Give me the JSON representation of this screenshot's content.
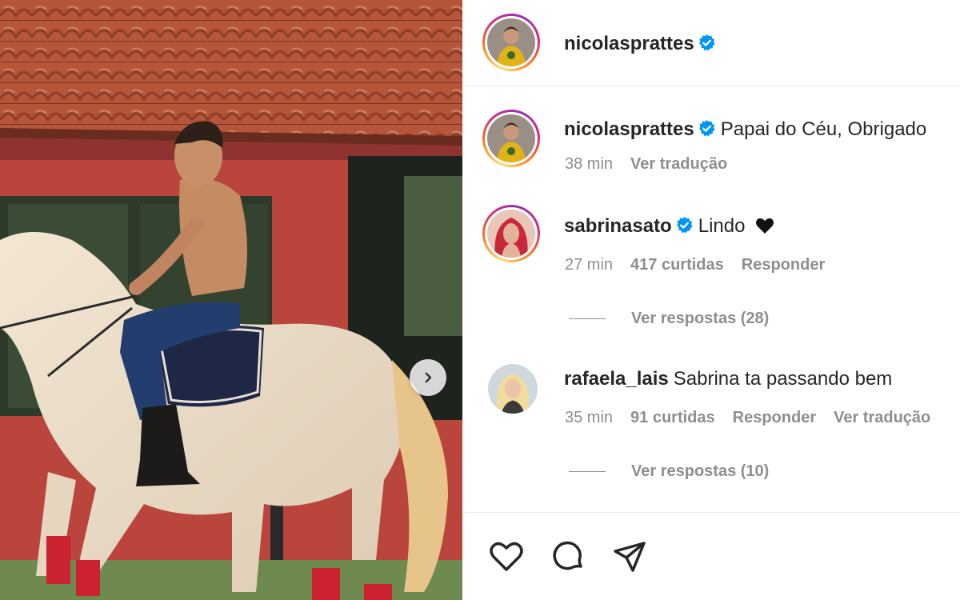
{
  "post": {
    "author": "nicolasprattes",
    "author_verified": true
  },
  "caption": {
    "username": "nicolasprattes",
    "text": "Papai do Céu, Obrigado",
    "time": "38 min",
    "translate": "Ver tradução"
  },
  "comments": [
    {
      "username": "sabrinasato",
      "verified": true,
      "text": "Lindo",
      "emoji": "black-heart",
      "time": "27 min",
      "likes": "417 curtidas",
      "reply": "Responder",
      "view_replies": "Ver respostas (28)"
    },
    {
      "username": "rafaela_lais",
      "verified": false,
      "text": "Sabrina ta passando bem",
      "time": "35 min",
      "likes": "91 curtidas",
      "reply": "Responder",
      "translate": "Ver tradução",
      "view_replies": "Ver respostas (10)"
    }
  ],
  "icons": {
    "like": "heart-icon",
    "comment": "comment-icon",
    "share": "share-icon",
    "next": "chevron-right-icon",
    "verified": "verified-badge-icon"
  },
  "colors": {
    "verified": "#0095f6",
    "text": "#262626",
    "secondary": "#8e8e8e",
    "story_ring": [
      "#feda75",
      "#fa7e1e",
      "#d62976",
      "#962fbf"
    ]
  }
}
